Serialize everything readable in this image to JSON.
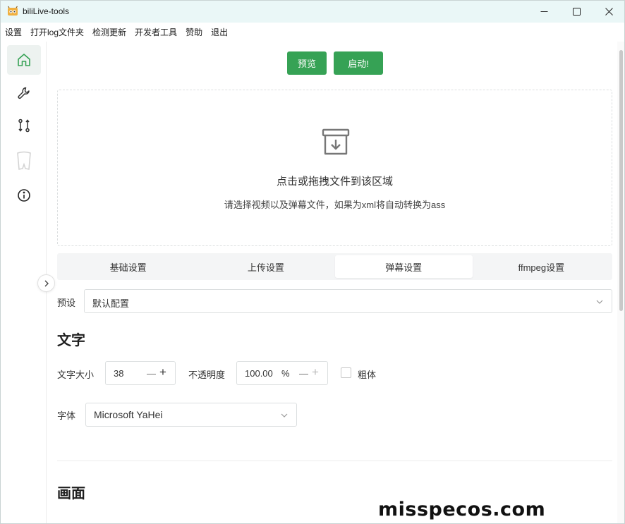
{
  "window": {
    "title": "biliLive-tools"
  },
  "menu": [
    "设置",
    "打开log文件夹",
    "检测更新",
    "开发者工具",
    "赞助",
    "退出"
  ],
  "sidebar": {
    "items": [
      {
        "icon": "home-icon",
        "active": true
      },
      {
        "icon": "wrench-icon",
        "active": false
      },
      {
        "icon": "git-compare-icon",
        "active": false
      },
      {
        "icon": "bilibili-tv-icon",
        "active": false
      },
      {
        "icon": "info-icon",
        "active": false
      }
    ]
  },
  "actions": {
    "preview": "预览",
    "start": "启动!"
  },
  "dropzone": {
    "title": "点击或拖拽文件到该区域",
    "subtitle": "请选择视频以及弹幕文件，如果为xml将自动转换为ass"
  },
  "tabs": [
    {
      "label": "基础设置",
      "active": false
    },
    {
      "label": "上传设置",
      "active": false
    },
    {
      "label": "弹幕设置",
      "active": true
    },
    {
      "label": "ffmpeg设置",
      "active": false
    }
  ],
  "preset": {
    "label": "预设",
    "value": "默认配置"
  },
  "text_section": {
    "heading": "文字",
    "font_size": {
      "label": "文字大小",
      "value": "38"
    },
    "opacity": {
      "label": "不透明度",
      "value": "100.00",
      "unit": "%"
    },
    "bold": {
      "label": "粗体",
      "checked": false
    },
    "font": {
      "label": "字体",
      "value": "Microsoft YaHei"
    }
  },
  "picture_section": {
    "heading": "画面"
  },
  "watermark": "misspecos.com",
  "colors": {
    "accent": "#36a255",
    "titlebar": "#eaf7f7"
  }
}
